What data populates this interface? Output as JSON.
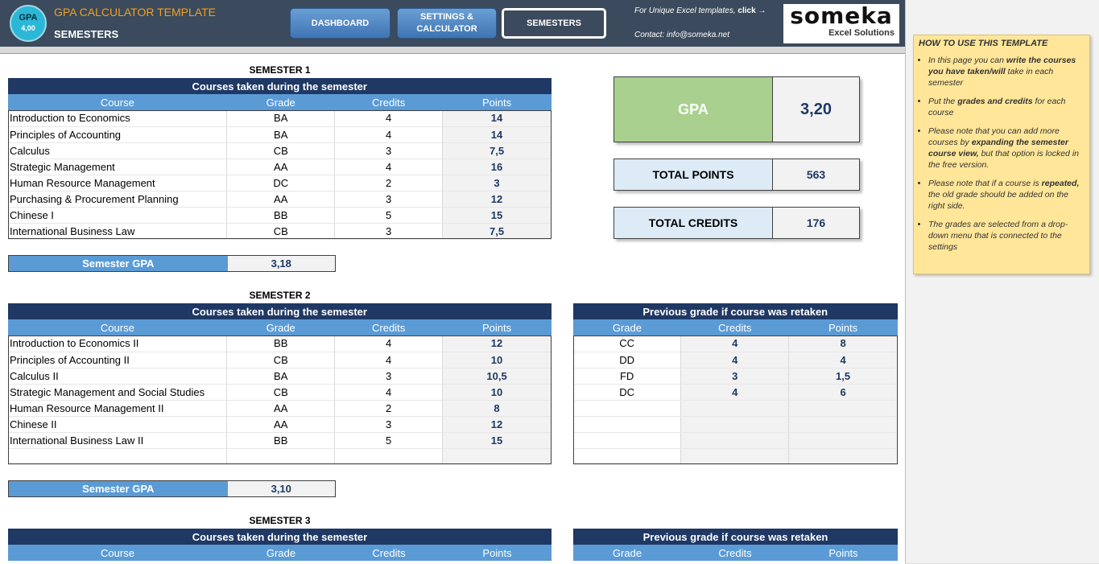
{
  "header": {
    "badge_top": "GPA",
    "badge_bottom": "4,00",
    "app_title": "GPA CALCULATOR TEMPLATE",
    "page_title": "SEMESTERS",
    "nav": [
      "DASHBOARD",
      "SETTINGS &\nCALCULATOR",
      "SEMESTERS"
    ],
    "promo_text": "For Unique Excel templates,",
    "promo_link": "click →",
    "contact": "Contact: info@someka.net",
    "brand": "someka",
    "brand_sub": "Excel Solutions"
  },
  "summary": {
    "gpa_label": "GPA",
    "gpa_value": "3,20",
    "total_points_label": "TOTAL POINTS",
    "total_points_value": "563",
    "total_credits_label": "TOTAL CREDITS",
    "total_credits_value": "176"
  },
  "columns": [
    "Course",
    "Grade",
    "Credits",
    "Points"
  ],
  "retake_columns": [
    "Grade",
    "Credits",
    "Points"
  ],
  "courses_caption": "Courses taken during the semester",
  "retake_caption": "Previous grade if course was retaken",
  "semester_gpa_label": "Semester GPA",
  "semesters": [
    {
      "title": "SEMESTER 1",
      "gpa": "3,18",
      "rows": [
        [
          "Introduction to Economics",
          "BA",
          "4",
          "14"
        ],
        [
          "Principles of Accounting",
          "BA",
          "4",
          "14"
        ],
        [
          "Calculus",
          "CB",
          "3",
          "7,5"
        ],
        [
          "Strategic Management",
          "AA",
          "4",
          "16"
        ],
        [
          "Human Resource Management",
          "DC",
          "2",
          "3"
        ],
        [
          "Purchasing & Procurement Planning",
          "AA",
          "3",
          "12"
        ],
        [
          "Chinese I",
          "BB",
          "5",
          "15"
        ],
        [
          "International Business Law",
          "CB",
          "3",
          "7,5"
        ]
      ]
    },
    {
      "title": "SEMESTER 2",
      "gpa": "3,10",
      "rows": [
        [
          "Introduction to Economics II",
          "BB",
          "4",
          "12"
        ],
        [
          "Principles of Accounting II",
          "CB",
          "4",
          "10"
        ],
        [
          "Calculus II",
          "BA",
          "3",
          "10,5"
        ],
        [
          "Strategic Management and Social Studies",
          "CB",
          "4",
          "10"
        ],
        [
          "Human Resource Management II",
          "AA",
          "2",
          "8"
        ],
        [
          "Chinese II",
          "AA",
          "3",
          "12"
        ],
        [
          "International Business Law II",
          "BB",
          "5",
          "15"
        ],
        [
          "",
          "",
          "",
          ""
        ]
      ],
      "retake": [
        [
          "CC",
          "4",
          "8"
        ],
        [
          "DD",
          "4",
          "4"
        ],
        [
          "FD",
          "3",
          "1,5"
        ],
        [
          "DC",
          "4",
          "6"
        ],
        [
          "",
          "",
          ""
        ],
        [
          "",
          "",
          ""
        ],
        [
          "",
          "",
          ""
        ],
        [
          "",
          "",
          ""
        ]
      ]
    },
    {
      "title": "SEMESTER 3"
    }
  ],
  "help": {
    "title": "HOW TO USE THIS TEMPLATE",
    "items": [
      [
        "In this page you can ",
        "write the courses you have taken/will",
        " take in each semester"
      ],
      [
        "Put the ",
        "grades and credits",
        " for each course"
      ],
      [
        "Please note that you can add more courses by ",
        "expanding the semester course view,",
        " but that option is locked in the free version."
      ],
      [
        "Please note that if a course is ",
        "repeated,",
        " the old grade should be added on the right side."
      ],
      [
        "The grades are selected from a drop-down menu that is connected to the settings",
        "",
        ""
      ]
    ]
  }
}
